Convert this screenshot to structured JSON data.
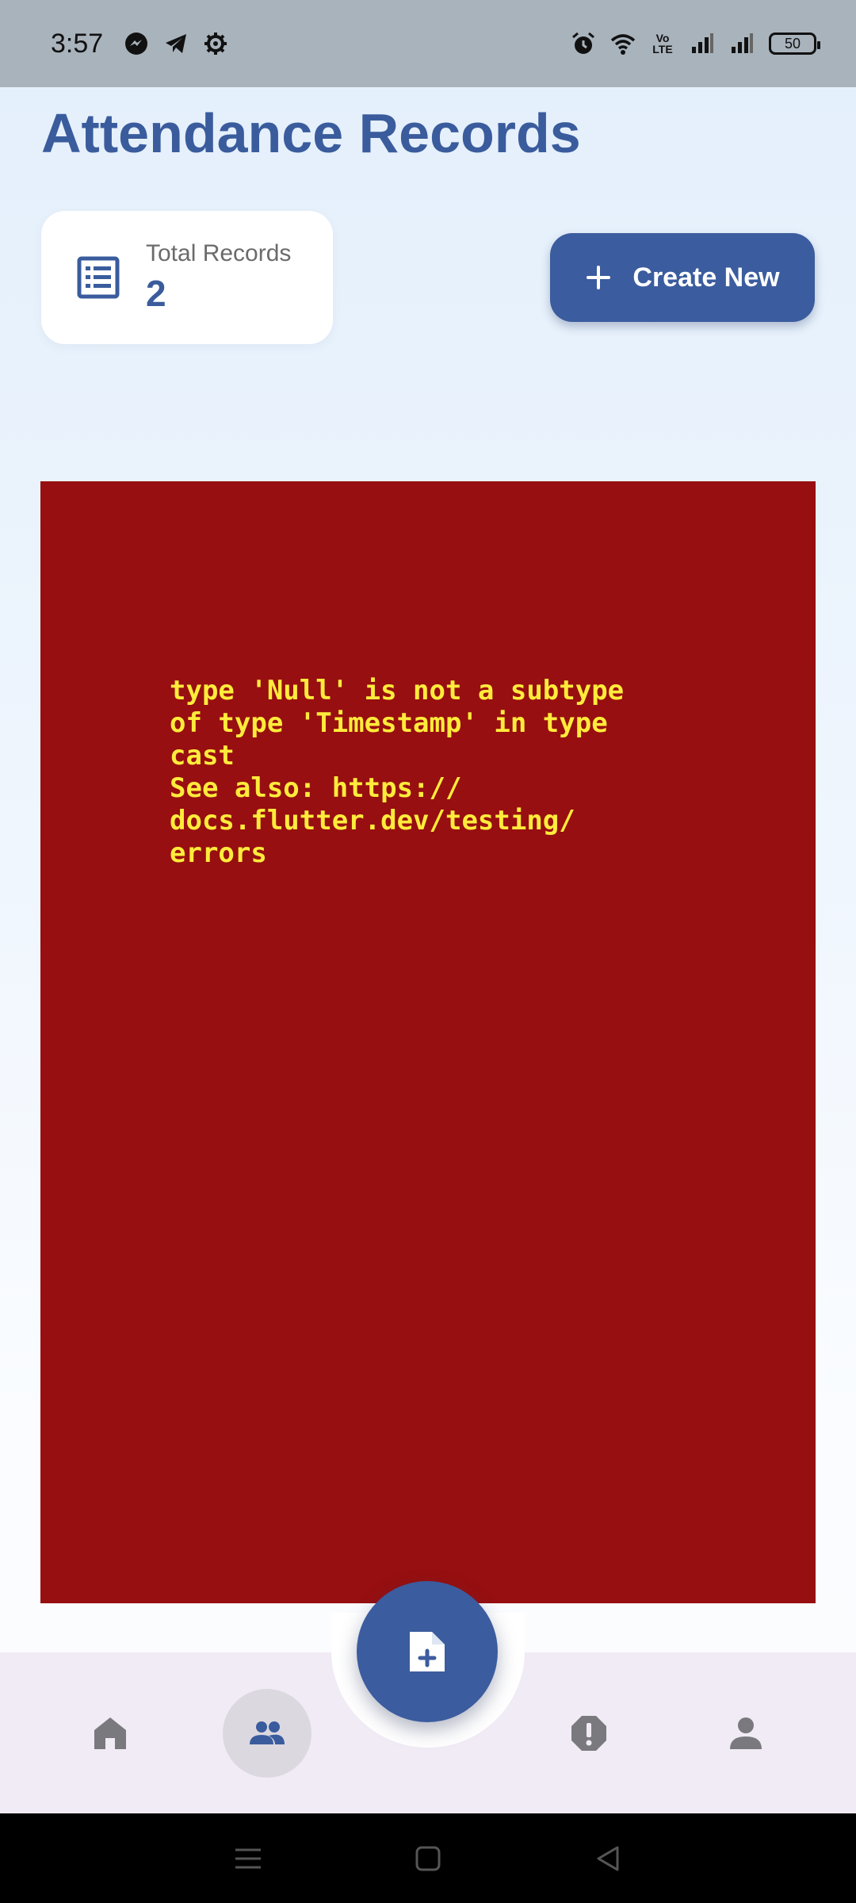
{
  "status_bar": {
    "time": "3:57",
    "icons_left": [
      "messenger-icon",
      "telegram-icon",
      "settings-gear-icon"
    ],
    "icons_right": [
      "alarm-icon",
      "wifi-icon",
      "volte-icon",
      "signal-icon",
      "signal-icon"
    ],
    "volte_top": "Vo",
    "volte_bottom": "LTE",
    "battery": "50"
  },
  "header": {
    "title": "Attendance Records"
  },
  "summary": {
    "label": "Total Records",
    "value": "2"
  },
  "actions": {
    "create_label": "Create New"
  },
  "error": {
    "message": "type 'Null' is not a subtype\nof type 'Timestamp' in type\ncast\nSee also: https://\ndocs.flutter.dev/testing/\nerrors"
  },
  "bottom_nav": {
    "items": [
      {
        "icon": "home-icon",
        "active": false
      },
      {
        "icon": "people-icon",
        "active": true
      },
      {
        "icon": "report-icon",
        "active": false
      },
      {
        "icon": "person-icon",
        "active": false
      }
    ],
    "fab_icon": "add-document-icon"
  },
  "colors": {
    "primary": "#3b5c9e",
    "error_bg": "#970f10",
    "error_text": "#ffeb3b",
    "nav_bg": "#f1ebf5"
  }
}
